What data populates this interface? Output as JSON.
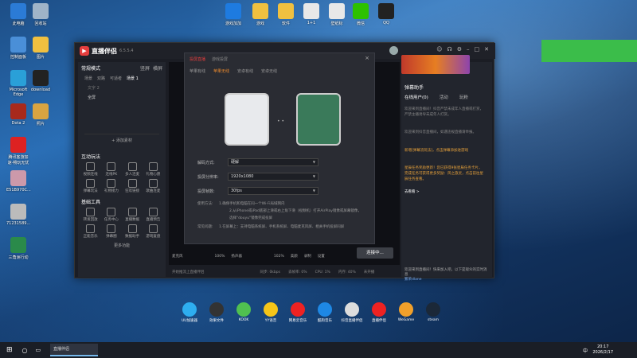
{
  "desktop_icons": [
    {
      "label": "此电脑",
      "name": "this-pc-icon",
      "color": "#2b7bd6"
    },
    {
      "label": "回收站",
      "name": "recycle-bin-icon",
      "color": "#9fb4c8"
    },
    {
      "label": "控制面板",
      "name": "control-panel-icon",
      "color": "#4a8fd8"
    },
    {
      "label": "图片",
      "name": "pictures-icon",
      "color": "#f0c040"
    },
    {
      "label": "Microsoft Edge",
      "name": "edge-icon",
      "color": "#2aa0d8"
    },
    {
      "label": "download",
      "name": "download-icon",
      "color": "#222"
    },
    {
      "label": "Dota 2",
      "name": "dota2-icon",
      "color": "#a8291c"
    },
    {
      "label": "照片",
      "name": "photos-icon",
      "color": "#d9a441"
    },
    {
      "label": "腾讯客游加速-畅玩无忧",
      "name": "game-accelerator-icon",
      "color": "#d22"
    },
    {
      "label": "E51B970C...",
      "name": "image-file-icon",
      "color": "#c9a"
    },
    {
      "label": "71231589...",
      "name": "image-file-icon-2",
      "color": "#bbb"
    },
    {
      "label": "三角洲行动",
      "name": "delta-force-icon",
      "color": "#2a8a4a"
    }
  ],
  "top_icons": [
    {
      "label": "游戏加加",
      "name": "game-plus-icon",
      "color": "#1e7be0"
    },
    {
      "label": "游戏",
      "name": "folder-icon",
      "color": "#f0c040"
    },
    {
      "label": "软件",
      "name": "folder-icon-2",
      "color": "#f0c040"
    },
    {
      "label": "1+1",
      "name": "file-icon",
      "color": "#e8e8e8"
    },
    {
      "label": "壁纸标",
      "name": "file-icon-2",
      "color": "#e8e8e8"
    },
    {
      "label": "微信",
      "name": "wechat-icon",
      "color": "#2dc100"
    },
    {
      "label": "QQ",
      "name": "qq-icon",
      "color": "#222"
    }
  ],
  "window": {
    "app_name": "直播伴侣",
    "version": "6.5.5.4",
    "left": {
      "mode": "常规模式",
      "tabs": [
        "横屏",
        "竖屏"
      ],
      "scene_row": [
        "场景",
        "双路",
        "可适者",
        "场景 1"
      ],
      "scene_items": [
        "文字 2",
        "全屏"
      ],
      "add_label": "+ 添加素材",
      "interact_title": "互动玩法",
      "interact_tools": [
        "视频连线",
        "连线PK",
        "多人连麦",
        "礼物心愿",
        "弹幕玩法",
        "礼物接力",
        "狂欢链接",
        "歌曲连麦"
      ],
      "basic_title": "基础工具",
      "basic_tools": [
        "转发回放",
        "任务中心",
        "直播数据",
        "直播预告",
        "正能音乐",
        "弹幕圈",
        "数据助手",
        "游戏复盘"
      ],
      "more": "更多功能"
    },
    "right": {
      "title": "弹幕助手",
      "tabs": [
        "在线用户(0)",
        "活动",
        "玩粉"
      ],
      "msg1": "欢迎来到直播间！抖音严禁未成年人直播或打赏，严禁主播诱导未成年人打赏。",
      "msg2": "欢迎来到抖音直播间，如遇违规直播请举报。",
      "msg3": "新增[弹幕流玩法]，点击弹幕添加进游戏",
      "msg4": "星辰任务奖励更新！您已获得9张星辰任务卡片，完成任务可获得更多奖励：风之旅灵，点击前往星辰任务查看。",
      "msg4_link": "去看看 >",
      "bottom": "欢迎来到直播间！快来加入吧，以下是观众的实时消息",
      "users": "繁荣dlane",
      "viewers": "16821"
    },
    "status": [
      "同步: 0kbps",
      "丢帧率: 0%",
      "CPU: 1%",
      "内存: 40%",
      "未开播"
    ],
    "status_tip": "开始推流上直播伴侣"
  },
  "dialog": {
    "tabs": [
      "投屏直播",
      "游戏投屏"
    ],
    "platform_tabs": [
      "苹果有线",
      "苹果无线",
      "安卓有线",
      "安卓无线"
    ],
    "fields": [
      {
        "label": "解码方式:",
        "value": "硬解"
      },
      {
        "label": "投屏分辨率:",
        "value": "1920x1080"
      },
      {
        "label": "投屏帧数:",
        "value": "30fps"
      }
    ],
    "help_title": "使用方法:",
    "help_lines": [
      "1.确保手机和电脑在同一个Wi-Fi局域网内",
      "2.从iPhone或iPad底部上滑或右上角下滑（视频机）打开AirPlay镜像或屏幕镜像，",
      "选择\"douyu\"镜像完成投屏"
    ],
    "faq_title": "常见问题:",
    "faq_text": "1.在屏幕上：支持电脑系统屏、手机系统屏、电脑麦克风屏、相关手机投屏同屏",
    "zoom1": "100%",
    "zoom2": "102%",
    "ctrl_labels": [
      "麦克风",
      "扬声器",
      "美颜",
      "录制",
      "设置"
    ],
    "golive": "连接中..."
  },
  "dock": [
    {
      "label": "UU加速器",
      "color": "#2eaef0"
    },
    {
      "label": "效果文件",
      "color": "#333"
    },
    {
      "label": "KOOK",
      "color": "#50c050"
    },
    {
      "label": "YY语音",
      "color": "#f5c518"
    },
    {
      "label": "网易云音乐",
      "color": "#e22"
    },
    {
      "label": "酷狗音乐",
      "color": "#1e88e5"
    },
    {
      "label": "抖音直播伴侣",
      "color": "#ddd"
    },
    {
      "label": "直播伴侣",
      "color": "#e22"
    },
    {
      "label": "WeGame",
      "color": "#f1a02a"
    },
    {
      "label": "steam",
      "color": "#1b2838"
    }
  ],
  "taskbar": {
    "app": "直播伴侣",
    "time": "20:17",
    "date": "2026/2/17",
    "lang": "中"
  }
}
